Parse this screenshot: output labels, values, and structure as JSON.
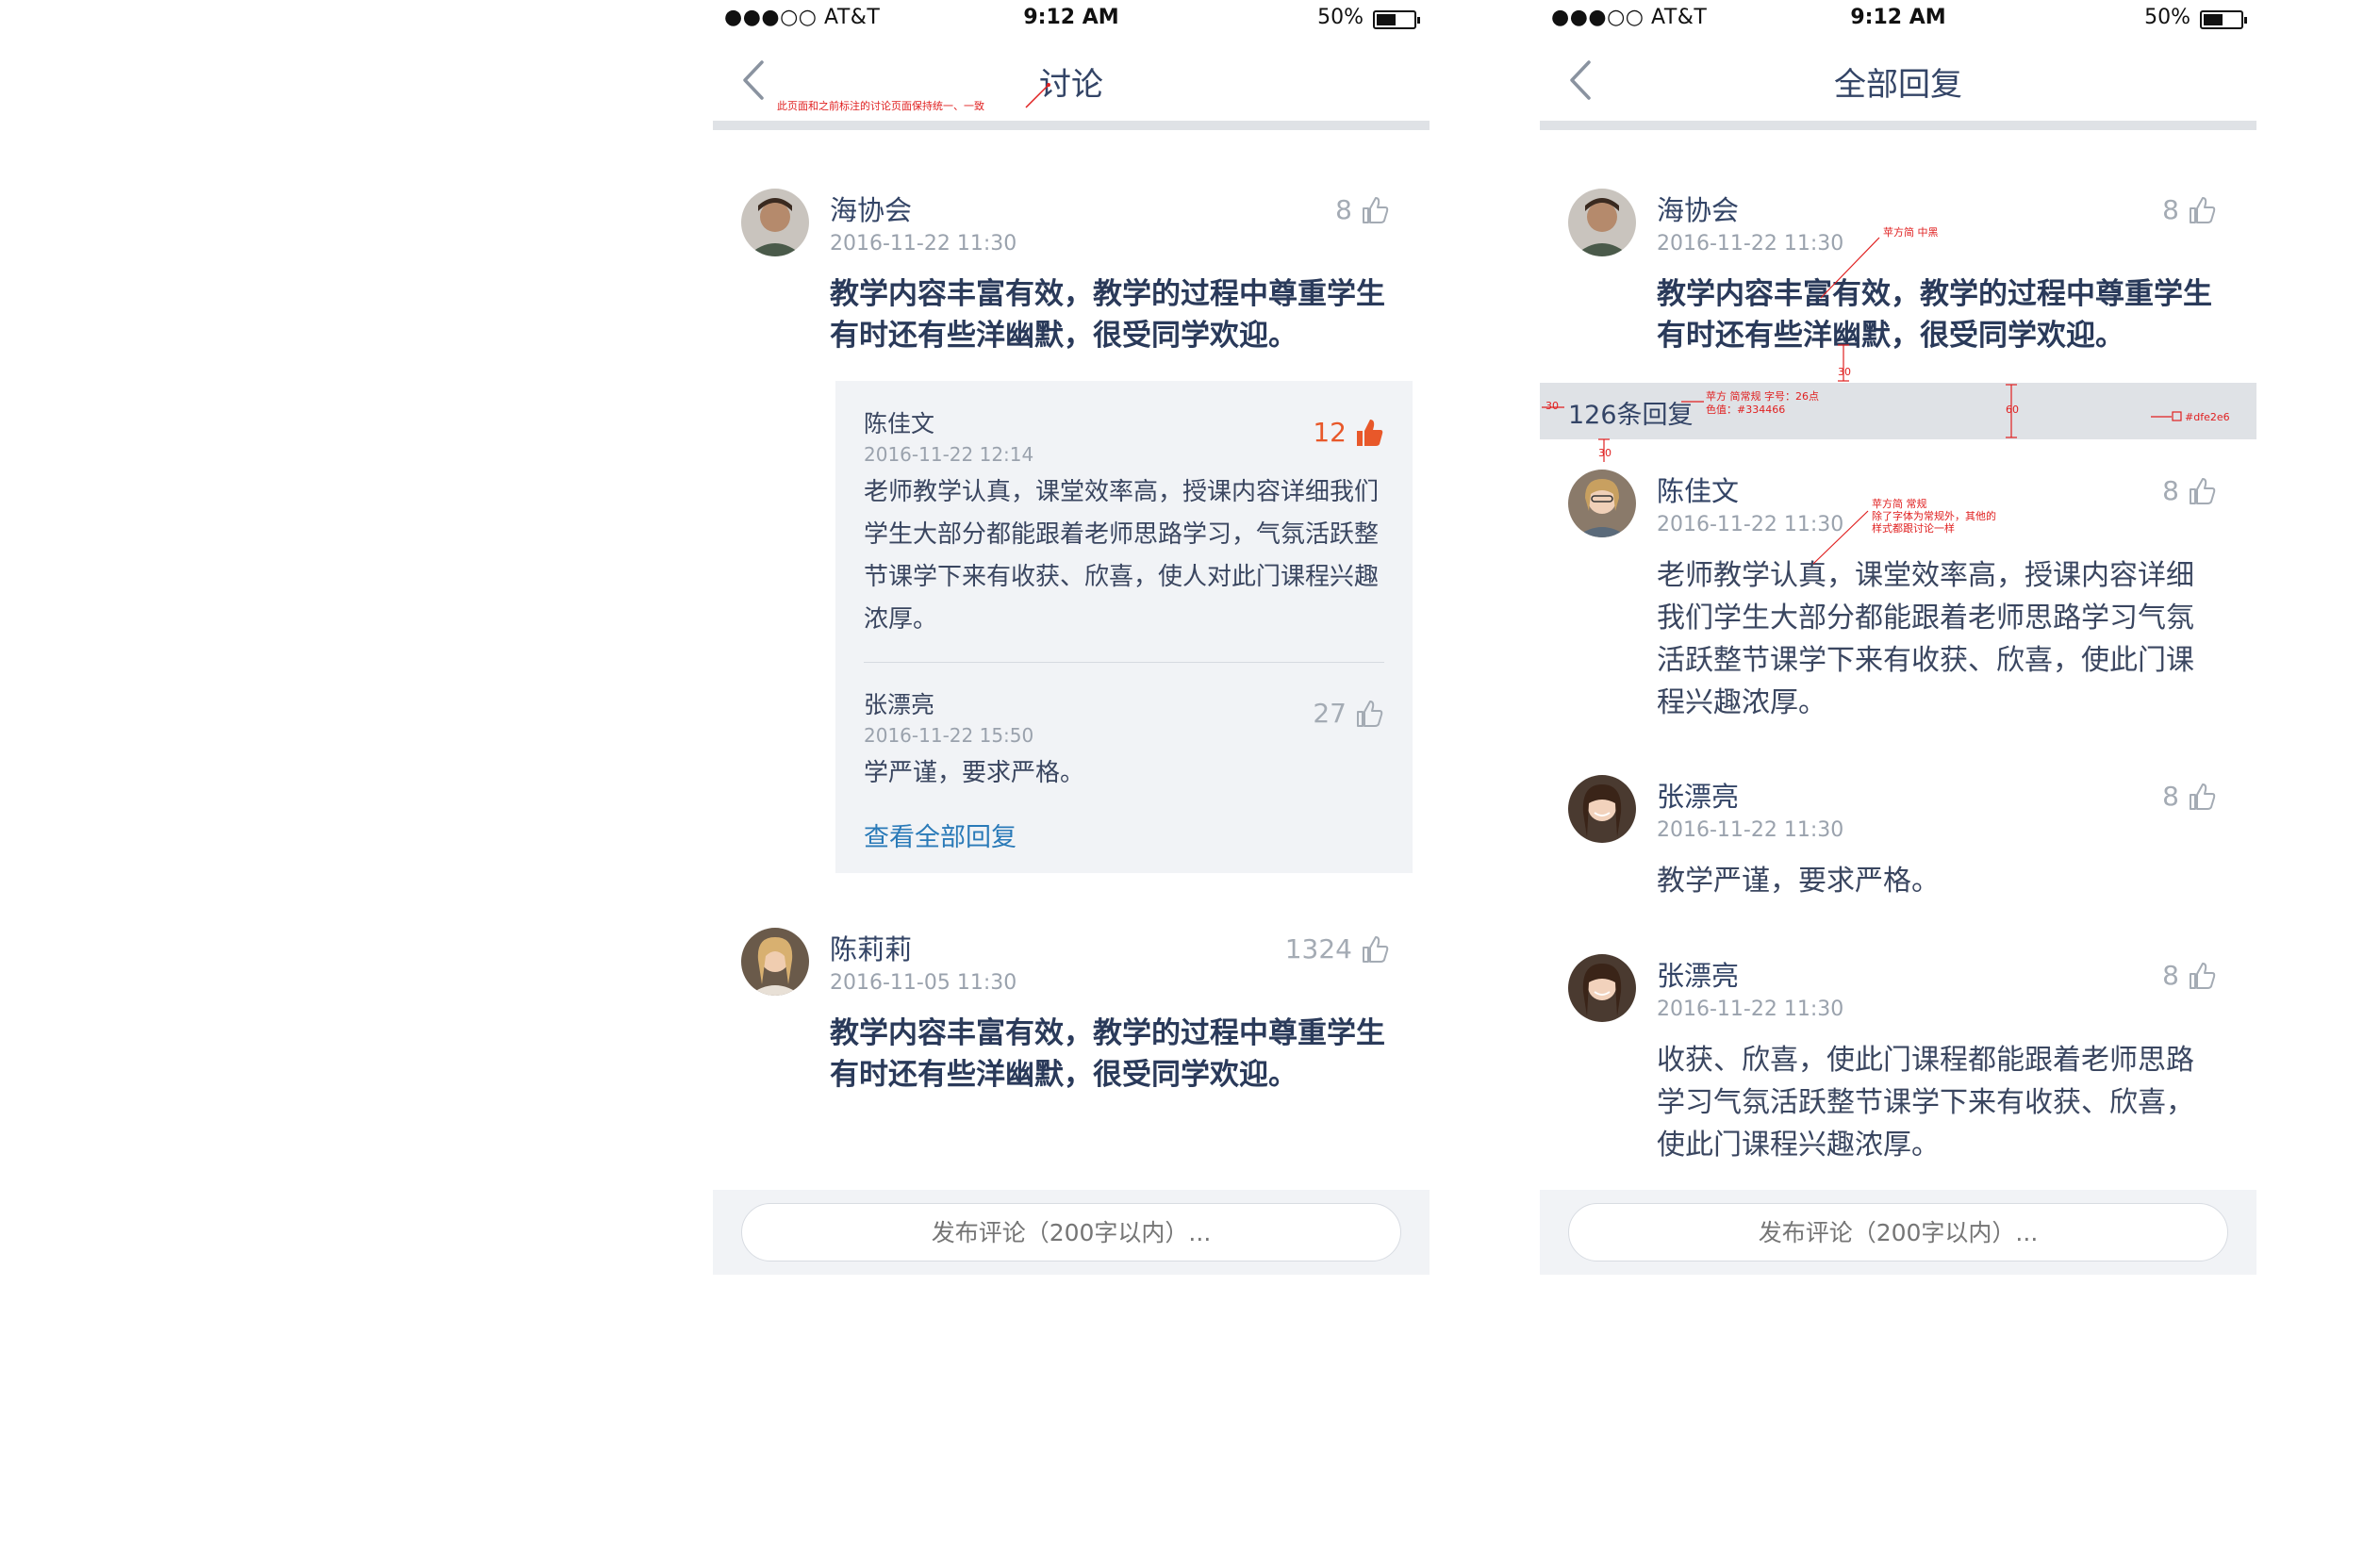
{
  "status_bar": {
    "carrier": "●●●○○ AT&T",
    "time": "9:12 AM",
    "battery": "50%"
  },
  "left_screen": {
    "title": "讨论",
    "annotation_title": "此页面和之前标注的讨论页面保持统一、一致",
    "comments": [
      {
        "author": "海协会",
        "date": "2016-11-22 11:30",
        "likes": "8",
        "text": "教学内容丰富有效，教学的过程中尊重学生有时还有些洋幽默，很受同学欢迎。"
      },
      {
        "author": "陈莉莉",
        "date": "2016-11-05 11:30",
        "likes": "1324",
        "text": "教学内容丰富有效，教学的过程中尊重学生有时还有些洋幽默，很受同学欢迎。"
      }
    ],
    "replies": [
      {
        "author": "陈佳文",
        "date": "2016-11-22 12:14",
        "likes": "12",
        "text": "老师教学认真，课堂效率高，授课内容详细我们学生大部分都能跟着老师思路学习，气氛活跃整节课学下来有收获、欣喜，使人对此门课程兴趣浓厚。"
      },
      {
        "author": "张漂亮",
        "date": "2016-11-22 15:50",
        "likes": "27",
        "text": "学严谨，要求严格。"
      }
    ],
    "view_all": "查看全部回复",
    "input_placeholder": "发布评论（200字以内）..."
  },
  "right_screen": {
    "title": "全部回复",
    "main_comment": {
      "author": "海协会",
      "date": "2016-11-22 11:30",
      "likes": "8",
      "text": "教学内容丰富有效，教学的过程中尊重学生有时还有些洋幽默，很受同学欢迎。"
    },
    "count_label": "126条回复",
    "replies": [
      {
        "author": "陈佳文",
        "date": "2016-11-22 11:30",
        "likes": "8",
        "text": "老师教学认真，课堂效率高，授课内容详细我们学生大部分都能跟着老师思路学习气氛活跃整节课学下来有收获、欣喜，使此门课程兴趣浓厚。"
      },
      {
        "author": "张漂亮",
        "date": "2016-11-22 11:30",
        "likes": "8",
        "text": "教学严谨，要求严格。"
      },
      {
        "author": "张漂亮",
        "date": "2016-11-22 11:30",
        "likes": "8",
        "text": "收获、欣喜，使此门课程都能跟着老师思路学习气氛活跃整节课学下来有收获、欣喜，使此门课程兴趣浓厚。"
      }
    ],
    "annotations": {
      "font_main": "苹方简 中黑",
      "spacing_30a": "30",
      "count_font": "苹方 简常规  字号：26点",
      "count_color": "色值：#334466",
      "bar_height": "60",
      "bar_color": "#dfe2e6",
      "left_30": "30",
      "spacing_30b": "30",
      "reply_font": "苹方简 常规",
      "reply_note_1": "除了字体为常规外，其他的",
      "reply_note_2": "样式都跟讨论一样"
    },
    "input_placeholder": "发布评论（200字以内）..."
  },
  "colors": {
    "text_primary": "#334466",
    "accent_like": "#e8582a",
    "link": "#2a7ab8",
    "divider": "#dfe2e6",
    "annotation": "#e02020"
  }
}
